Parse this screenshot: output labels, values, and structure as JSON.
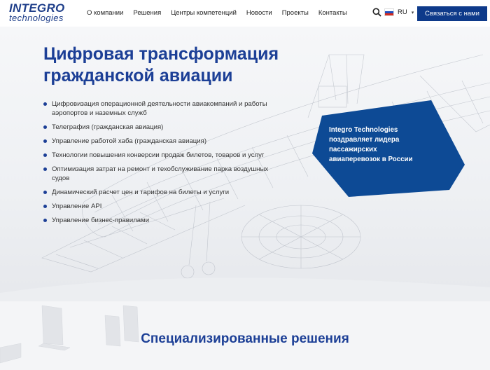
{
  "logo": {
    "main": "INTEGRO",
    "sub": "technologies"
  },
  "nav": {
    "items": [
      "О компании",
      "Решения",
      "Центры компетенций",
      "Новости",
      "Проекты",
      "Контакты"
    ],
    "search_icon": "search-icon",
    "language": "RU",
    "contact_button": "Связаться с нами"
  },
  "hero": {
    "title_line1": "Цифровая трансформация",
    "title_line2": "гражданской авиации",
    "bullets": [
      [
        "Цифровизация операционной деятельности авиакомпаний и работы",
        "аэропортов и наземных служб"
      ],
      [
        "Телеграфия (гражданская авиация)"
      ],
      [
        "Управление работой хаба (гражданская авиация)"
      ],
      [
        "Технологии повышения конверсии продаж билетов, товаров и услуг"
      ],
      [
        "Оптимизация затрат на ремонт и техобслуживание парка воздушных",
        "судов"
      ],
      [
        "Динамический расчет цен и тарифов на билеты и услуги"
      ],
      [
        "Управление API"
      ],
      [
        "Управление бизнес-правилами"
      ]
    ],
    "news": {
      "line1": "Integro Technologies",
      "line2": "поздравляет лидера",
      "line3": "пассажирских",
      "line4": "авиаперевозок в России"
    }
  },
  "section": {
    "title": "Специализированные решения"
  },
  "colors": {
    "brand": "#1c3f96",
    "button": "#0e3a8a",
    "badge": "#0d4a95"
  }
}
